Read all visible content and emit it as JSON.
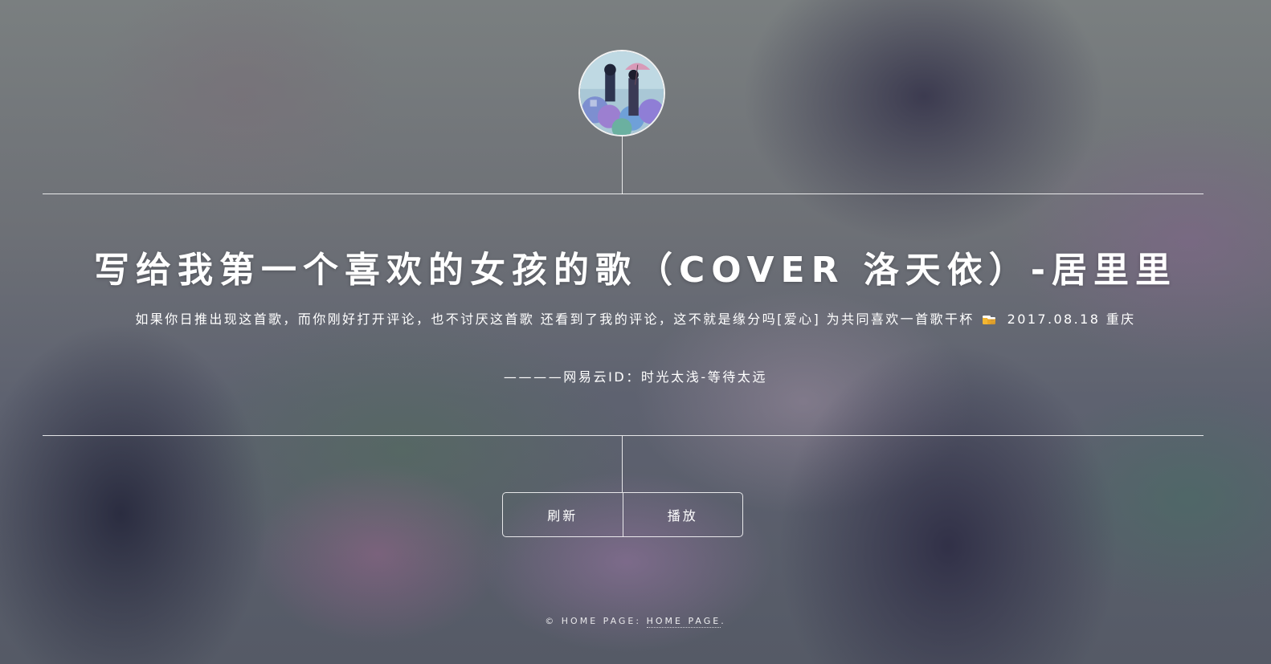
{
  "hero": {
    "title": "写给我第一个喜欢的女孩的歌（COVER 洛天依）-居里里",
    "description_before_emoji": "如果你日推出现这首歌，而你刚好打开评论，也不讨厌这首歌 还看到了我的评论，这不就是缘分吗[爱心] 为共同喜欢一首歌干杯",
    "description_after_emoji": "2017.08.18 重庆",
    "signature": "————网易云ID：时光太浅-等待太远",
    "emoji_icon": "beer-icon"
  },
  "buttons": {
    "refresh_label": "刷新",
    "play_label": "播放"
  },
  "footer": {
    "copyright_prefix": "© HOME PAGE:",
    "link_label": "HOME PAGE",
    "suffix": "."
  }
}
